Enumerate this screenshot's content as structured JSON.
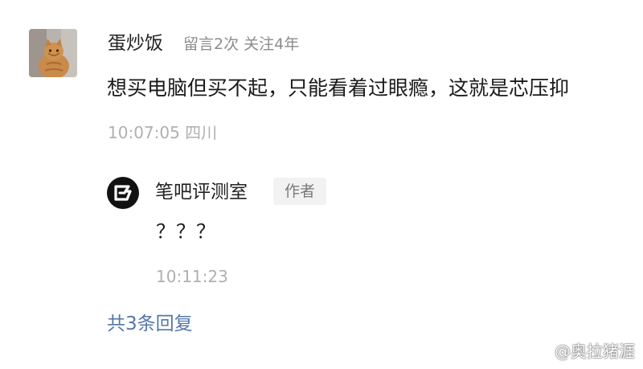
{
  "comment": {
    "user": {
      "name": "蛋炒饭",
      "meta": "留言2次 关注4年",
      "avatar": "cat-avatar"
    },
    "text": "想买电脑但买不起，只能看着过眼瘾，这就是芯压抑",
    "time": "10:07:05 四川"
  },
  "reply": {
    "user": {
      "name": "笔吧评测室",
      "badge": "作者",
      "avatar": "bibar-logo-icon"
    },
    "text": "？？？",
    "time": "10:11:23"
  },
  "more_replies": "共3条回复",
  "watermark": {
    "text": "@奥拉猪涯",
    "icon": "weibo-icon"
  },
  "colors": {
    "link": "#5577a8",
    "meta": "#8c8c8c",
    "time": "#b0b0b0",
    "badge_bg": "#f2f2f2"
  }
}
